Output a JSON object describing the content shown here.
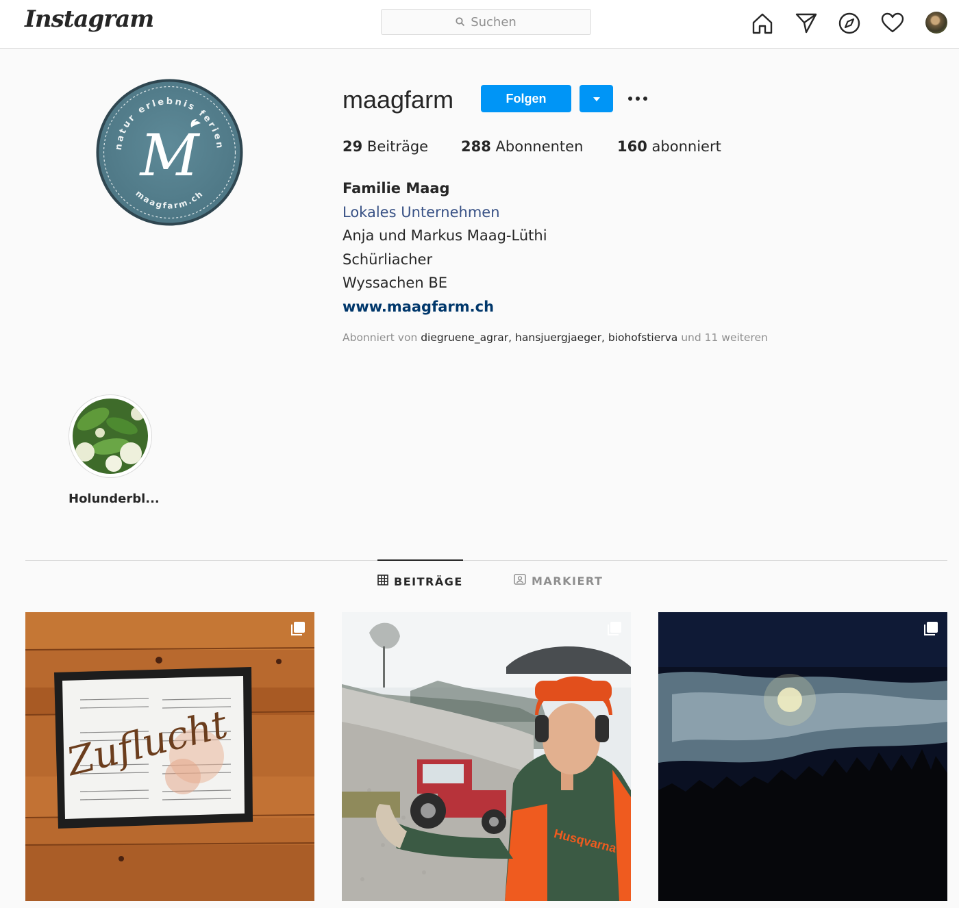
{
  "app": {
    "logo": "Instagram"
  },
  "search": {
    "placeholder": "Suchen"
  },
  "nav": {
    "icons": [
      "home-icon",
      "direct-icon",
      "explore-icon",
      "activity-icon",
      "profile-avatar"
    ]
  },
  "profile": {
    "username": "maagfarm",
    "follow_label": "Folgen",
    "stats": {
      "posts_count": "29",
      "posts_label": "Beiträge",
      "followers_count": "288",
      "followers_label": "Abonnenten",
      "following_count": "160",
      "following_label": "abonniert"
    },
    "bio": {
      "name": "Familie Maag",
      "category": "Lokales Unternehmen",
      "line1": "Anja und Markus Maag-Lüthi",
      "line2": "Schürliacher",
      "line3": "Wyssachen BE",
      "website": "www.maagfarm.ch"
    },
    "followed_by": {
      "prefix": "Abonniert von",
      "users": [
        "diegruene_agrar",
        "hansjuergjaeger",
        "biohofstierva"
      ],
      "suffix": "und 11 weiteren"
    },
    "logo_text": {
      "top": "natur erlebnis ferien",
      "monogram": "M",
      "bottom": "maagfarm.ch"
    }
  },
  "highlights": [
    {
      "label": "Holunderbl..."
    }
  ],
  "tabs": [
    {
      "label": "BEITRÄGE",
      "active": true
    },
    {
      "label": "MARKIERT",
      "active": false
    }
  ],
  "posts": [
    {
      "overlay_text": "Zuflucht",
      "multi": true
    },
    {
      "brand_text": "Husqvarna",
      "multi": true
    },
    {
      "multi": true
    }
  ],
  "colors": {
    "accent": "#0095f6",
    "link": "#00376b",
    "category": "#385185"
  }
}
